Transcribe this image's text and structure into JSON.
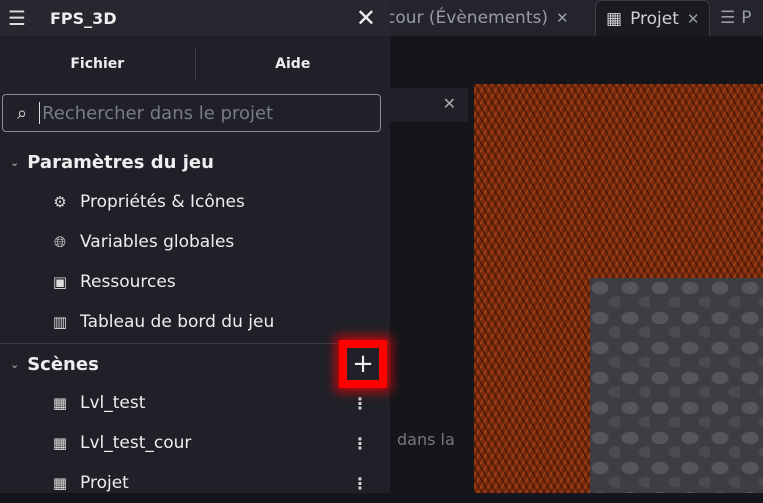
{
  "window": {
    "title": "FPS_3D"
  },
  "menubar": {
    "file": "Fichier",
    "help": "Aide"
  },
  "search": {
    "placeholder": "Rechercher dans le projet",
    "value": ""
  },
  "tabs": [
    {
      "label": "cour (Évènements)",
      "icon": "events-icon"
    },
    {
      "label": "Projet",
      "icon": "film-icon",
      "active": true
    },
    {
      "label": "P",
      "icon": "layers-icon"
    }
  ],
  "background_text": "dans la",
  "game_settings": {
    "label": "Paramètres du jeu",
    "items": [
      {
        "label": "Propriétés & Icônes",
        "icon": "gear-icon"
      },
      {
        "label": "Variables globales",
        "icon": "globe-icon"
      },
      {
        "label": "Ressources",
        "icon": "resources-icon"
      },
      {
        "label": "Tableau de bord du jeu",
        "icon": "chart-icon"
      }
    ]
  },
  "scenes": {
    "label": "Scènes",
    "add_label": "+",
    "items": [
      {
        "label": "Lvl_test"
      },
      {
        "label": "Lvl_test_cour"
      },
      {
        "label": "Projet"
      }
    ]
  },
  "colors": {
    "highlight": "#ff0000"
  }
}
